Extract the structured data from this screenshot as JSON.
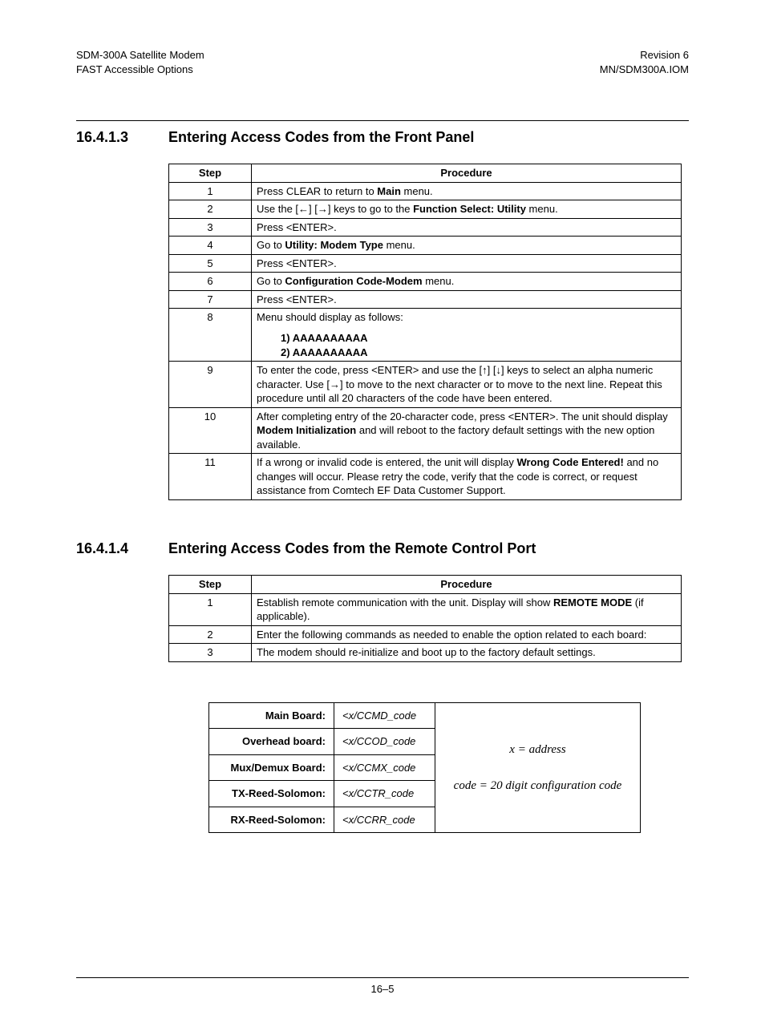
{
  "header": {
    "left1": "SDM-300A Satellite Modem",
    "left2": "FAST Accessible Options",
    "right1": "Revision 6",
    "right2": "MN/SDM300A.IOM"
  },
  "section1": {
    "num": "16.4.1.3",
    "title": "Entering Access Codes from the Front Panel",
    "th_step": "Step",
    "th_proc": "Procedure",
    "rows": {
      "r1": {
        "step": "1",
        "procA": "Press CLEAR to return to ",
        "procB": "Main",
        "procC": " menu."
      },
      "r2": {
        "step": "2",
        "procA": "Use the [←] [→] keys to go to the ",
        "procB": "Function Select: Utility",
        "procC": " menu."
      },
      "r3": {
        "step": "3",
        "proc": "Press <ENTER>."
      },
      "r4": {
        "step": "4",
        "procA": "Go to ",
        "procB": "Utility: Modem Type",
        "procC": " menu."
      },
      "r5": {
        "step": "5",
        "proc": "Press <ENTER>."
      },
      "r6": {
        "step": "6",
        "procA": "Go to ",
        "procB": "Configuration Code-Modem",
        "procC": " menu."
      },
      "r7": {
        "step": "7",
        "proc": "Press <ENTER>."
      },
      "r8": {
        "step": "8",
        "procA": "Menu should display as follows:",
        "disp1": "1) AAAAAAAAAA",
        "disp2": "2) AAAAAAAAAA"
      },
      "r9": {
        "step": "9",
        "proc": "To enter the code, press <ENTER> and use the  [↑] [↓] keys to select an alpha numeric character. Use [→] to move to the next character or to move to the next line. Repeat this procedure until all 20 characters of the code have been entered."
      },
      "r10": {
        "step": "10",
        "procA": "After completing entry of  the 20-character code, press <ENTER>. The unit should display ",
        "procB": "Modem Initialization",
        "procC": " and will reboot to the factory default settings with the new option available."
      },
      "r11": {
        "step": "11",
        "procA": "If a wrong or invalid code is entered, the unit will display ",
        "procB": "Wrong Code Entered!",
        "procC": " and  no changes will occur. Please retry the code, verify that the code is correct, or request assistance from Comtech EF Data Customer Support."
      }
    }
  },
  "section2": {
    "num": "16.4.1.4",
    "title": "Entering Access Codes from the Remote Control Port",
    "th_step": "Step",
    "th_proc": "Procedure",
    "rows": {
      "r1": {
        "step": "1",
        "procA": "Establish remote communication with the unit. Display will show ",
        "procB": "REMOTE MODE",
        "procC": " (if applicable)."
      },
      "r2": {
        "step": "2",
        "proc": "Enter the following commands as needed to enable the option related to each board:"
      },
      "r3": {
        "step": "3",
        "proc": "The modem should re-initialize and boot up to the factory default settings."
      }
    }
  },
  "cmdtable": {
    "r1": {
      "label": "Main Board:",
      "code": "<x/CCMD_code"
    },
    "r2": {
      "label": "Overhead board:",
      "code": "<x/CCOD_code"
    },
    "r3": {
      "label": "Mux/Demux Board:",
      "code": "<x/CCMX_code"
    },
    "r4": {
      "label": "TX-Reed-Solomon:",
      "code": "<x/CCTR_code"
    },
    "r5": {
      "label": "RX-Reed-Solomon:",
      "code": "<x/CCRR_code"
    },
    "note1": "x = address",
    "note2": "code = 20 digit configuration code"
  },
  "footer": {
    "page": "16–5"
  }
}
